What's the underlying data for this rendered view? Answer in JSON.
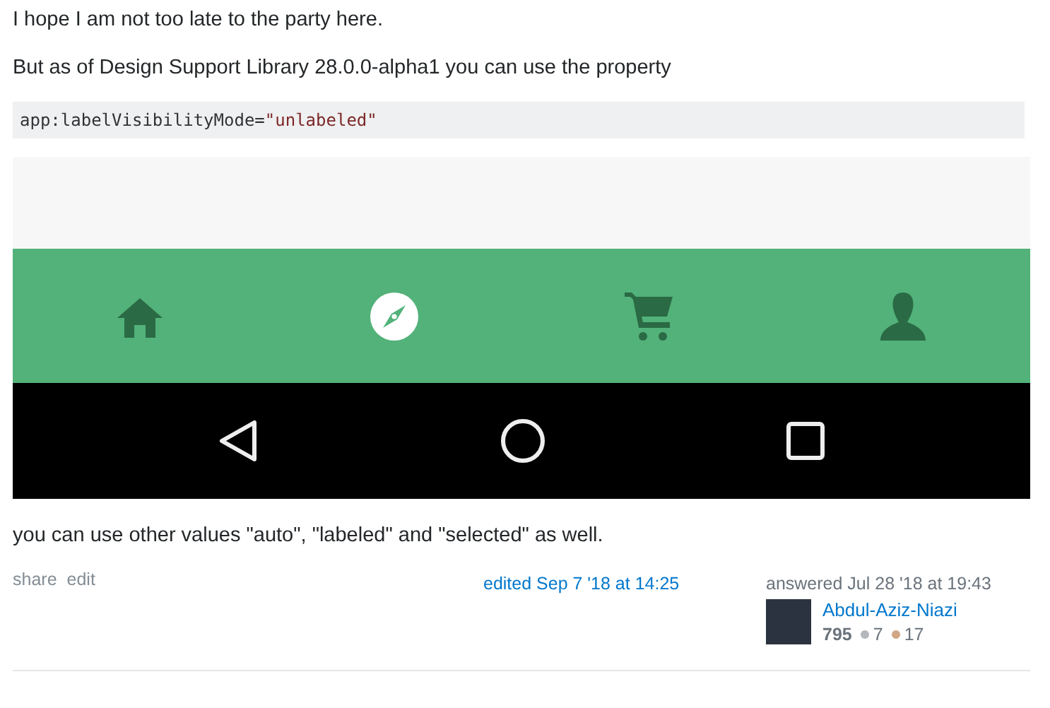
{
  "paragraphs": [
    "I hope I am not too late to the party here.",
    "But as of Design Support Library 28.0.0-alpha1 you can use the property"
  ],
  "code": {
    "attribute": "app:labelVisibilityMode=",
    "value": "\"unlabeled\""
  },
  "screenshot": {
    "nav_items": [
      {
        "kind": "home",
        "selected": false
      },
      {
        "kind": "compass",
        "selected": true
      },
      {
        "kind": "cart",
        "selected": false
      },
      {
        "kind": "person",
        "selected": false
      }
    ],
    "system_buttons": [
      {
        "kind": "back"
      },
      {
        "kind": "home"
      },
      {
        "kind": "recents"
      }
    ]
  },
  "after_text": "you can use other values \"auto\", \"labeled\" and \"selected\" as well.",
  "post_menu": [
    "share",
    "edit"
  ],
  "edited": "edited Sep 7 '18 at 14:25",
  "user": {
    "action": "answered Jul 28 '18 at 19:43",
    "name": "Abdul-Aziz-Niazi",
    "reputation": "795",
    "silver": "7",
    "bronze": "17"
  }
}
